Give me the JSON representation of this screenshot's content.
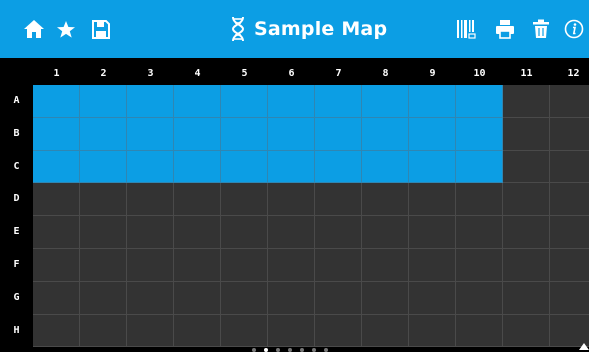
{
  "toolbar": {
    "icons": [
      "home-icon",
      "star-icon",
      "save-icon",
      "dna-icon",
      "barcode-icon",
      "print-icon",
      "trash-icon",
      "info-icon"
    ]
  },
  "title": "Sample Map",
  "grid": {
    "columns": [
      "1",
      "2",
      "3",
      "4",
      "5",
      "6",
      "7",
      "8",
      "9",
      "10",
      "11",
      "12"
    ],
    "rows": [
      "A",
      "B",
      "C",
      "D",
      "E",
      "F",
      "G",
      "H"
    ],
    "selected_rows": [
      "A",
      "B",
      "C"
    ],
    "selected_columns": [
      "1",
      "2",
      "3",
      "4",
      "5",
      "6",
      "7",
      "8",
      "9",
      "10"
    ]
  },
  "pagination": {
    "pages": 7,
    "active": 2
  },
  "colors": {
    "accent": "#0c9ee4",
    "cell": "#333333",
    "background": "#000000"
  }
}
